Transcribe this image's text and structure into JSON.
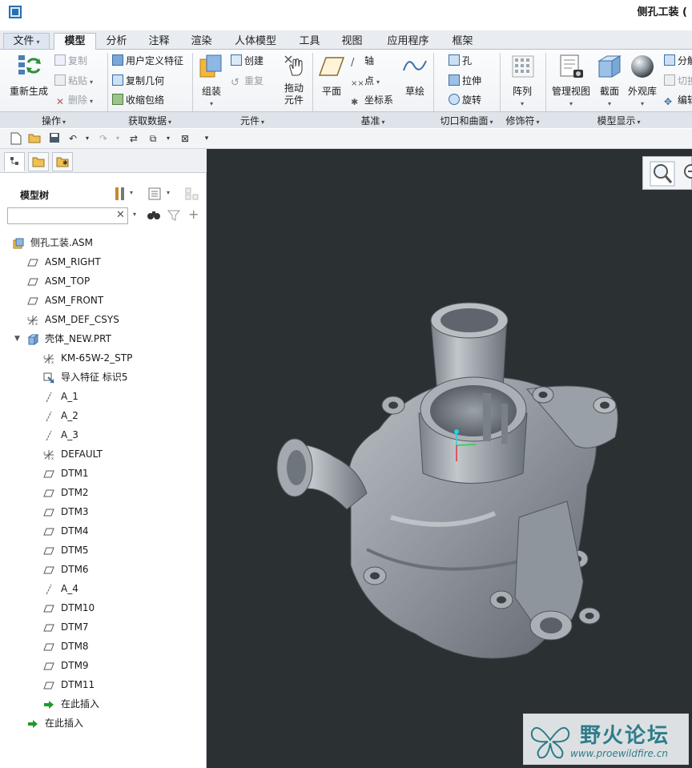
{
  "window": {
    "title": "侧孔工装 ("
  },
  "tabs": [
    {
      "label": "文件",
      "dropdown": "▾"
    },
    {
      "label": "模型"
    },
    {
      "label": "分析"
    },
    {
      "label": "注释"
    },
    {
      "label": "渲染"
    },
    {
      "label": "人体模型"
    },
    {
      "label": "工具"
    },
    {
      "label": "视图"
    },
    {
      "label": "应用程序"
    },
    {
      "label": "框架"
    }
  ],
  "ribbon": {
    "regenerate": "重新生成",
    "copy": "复制",
    "paste": "粘贴",
    "delete": "删除",
    "udf": "用户定义特征",
    "copy_geometry": "复制几何",
    "shrinkwrap": "收缩包络",
    "assemble": "组装",
    "create": "创建",
    "repeat": "重复",
    "drag_component_1": "拖动",
    "drag_component_2": "元件",
    "plane": "平面",
    "axis": "轴",
    "point": "点",
    "csys": "坐标系",
    "sketch": "草绘",
    "hole": "孔",
    "extrude": "拉伸",
    "revolve": "旋转",
    "pattern": "阵列",
    "manage_views": "管理视图",
    "section": "截面",
    "appearance": "外观库",
    "explode_1": "分解",
    "explode_2": "切换",
    "explode_3": "编辑"
  },
  "groups": [
    {
      "label": "操作"
    },
    {
      "label": "获取数据"
    },
    {
      "label": "元件"
    },
    {
      "label": "基准"
    },
    {
      "label": "切口和曲面"
    },
    {
      "label": "修饰符"
    },
    {
      "label": "模型显示"
    }
  ],
  "model_tree": {
    "title": "模型树",
    "search_value": "",
    "items": [
      {
        "label": "侧孔工装.ASM",
        "icon": "assembly-icon"
      },
      {
        "label": "ASM_RIGHT",
        "icon": "datum-plane-icon"
      },
      {
        "label": "ASM_TOP",
        "icon": "datum-plane-icon"
      },
      {
        "label": "ASM_FRONT",
        "icon": "datum-plane-icon"
      },
      {
        "label": "ASM_DEF_CSYS",
        "icon": "csys-icon"
      },
      {
        "label": "壳体_NEW.PRT",
        "icon": "part-icon"
      },
      {
        "label": "KM-65W-2_STP",
        "icon": "csys-icon"
      },
      {
        "label": "导入特征 标识5",
        "icon": "import-feature-icon"
      },
      {
        "label": "A_1",
        "icon": "datum-axis-icon"
      },
      {
        "label": "A_2",
        "icon": "datum-axis-icon"
      },
      {
        "label": "A_3",
        "icon": "datum-axis-icon"
      },
      {
        "label": "DEFAULT",
        "icon": "csys-icon"
      },
      {
        "label": "DTM1",
        "icon": "datum-plane-icon"
      },
      {
        "label": "DTM2",
        "icon": "datum-plane-icon"
      },
      {
        "label": "DTM3",
        "icon": "datum-plane-icon"
      },
      {
        "label": "DTM4",
        "icon": "datum-plane-icon"
      },
      {
        "label": "DTM5",
        "icon": "datum-plane-icon"
      },
      {
        "label": "DTM6",
        "icon": "datum-plane-icon"
      },
      {
        "label": "A_4",
        "icon": "datum-axis-icon"
      },
      {
        "label": "DTM10",
        "icon": "datum-plane-icon"
      },
      {
        "label": "DTM7",
        "icon": "datum-plane-icon"
      },
      {
        "label": "DTM8",
        "icon": "datum-plane-icon"
      },
      {
        "label": "DTM9",
        "icon": "datum-plane-icon"
      },
      {
        "label": "DTM11",
        "icon": "datum-plane-icon"
      },
      {
        "label": "在此插入",
        "icon": "insert-here-icon"
      },
      {
        "label": "在此插入",
        "icon": "insert-here-icon"
      }
    ]
  },
  "watermark": {
    "title": "野火论坛",
    "url": "www.proewildfire.cn"
  },
  "colors": {
    "viewport_bg": "#2b3033",
    "model": "#8e949b",
    "ribbon_bg": "#f3f5f7"
  }
}
